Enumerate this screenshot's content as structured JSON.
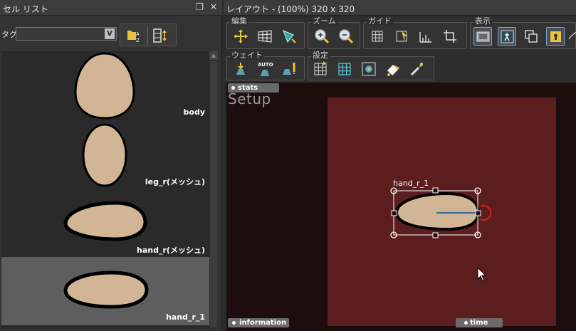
{
  "left_panel": {
    "title": "セル リスト",
    "tag_label": "タグ",
    "tag_value": "",
    "cells": [
      {
        "label": "body",
        "selected": false
      },
      {
        "label": "leg_r(メッシュ)",
        "selected": false
      },
      {
        "label": "hand_r(メッシュ)",
        "selected": false
      },
      {
        "label": "hand_r_1",
        "selected": true
      }
    ]
  },
  "right_panel": {
    "title": "レイアウト - (100%) 320 x 320",
    "groups": {
      "edit": "編集",
      "zoom": "ズーム",
      "guide": "ガイド",
      "display": "表示",
      "weight": "ウェイト",
      "settings": "設定"
    },
    "viewport": {
      "stats_tab": "stats",
      "info_tab": "information",
      "time_tab": "time",
      "mode_text": "Setup",
      "selected_label": "hand_r_1"
    }
  },
  "colors": {
    "panel_bg": "#333333",
    "viewport_bg": "#1d0d0d",
    "canvas_bg": "#5c1d1f",
    "shape_fill": "#d2b595",
    "selection_row": "#5e5e5e"
  },
  "icons": [
    "pin-icon",
    "close-icon",
    "sort-icon",
    "arrange-icon",
    "move-icon",
    "mesh-icon",
    "rotate-icon",
    "zoom-in-icon",
    "zoom-out-icon",
    "grid-icon",
    "guide-icon",
    "ruler-icon",
    "crop-icon",
    "frame-icon",
    "bone-icon",
    "layer-icon",
    "lock-icon",
    "weight-icon",
    "auto-weight-icon",
    "brush-icon"
  ]
}
